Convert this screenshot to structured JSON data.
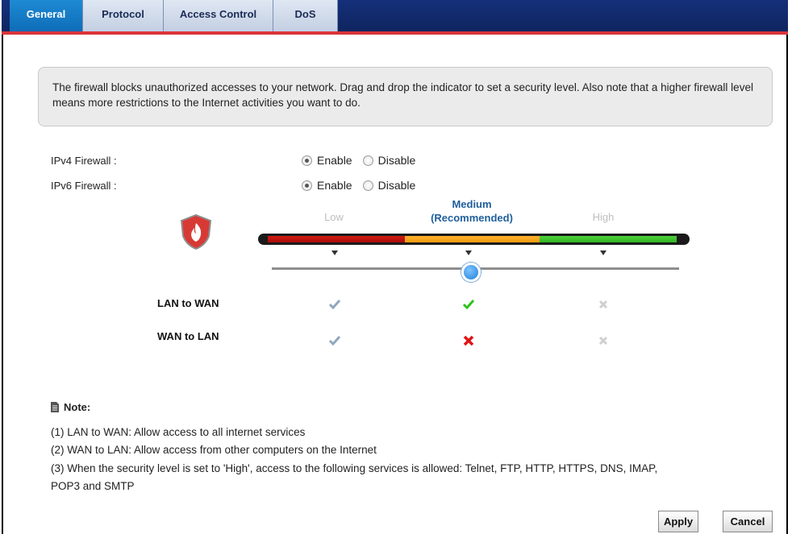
{
  "tabs": [
    {
      "label": "General",
      "active": true
    },
    {
      "label": "Protocol",
      "active": false
    },
    {
      "label": "Access Control",
      "active": false
    },
    {
      "label": "DoS",
      "active": false
    }
  ],
  "description": "The firewall blocks unauthorized accesses to your network. Drag and drop the indicator to set a security level. Also note that a higher firewall level means more restrictions to the Internet activities you want to do.",
  "ipv4": {
    "label": "IPv4 Firewall :",
    "options": [
      "Enable",
      "Disable"
    ],
    "selected": "Enable"
  },
  "ipv6": {
    "label": "IPv6 Firewall :",
    "options": [
      "Enable",
      "Disable"
    ],
    "selected": "Enable"
  },
  "levels": {
    "low": "Low",
    "medium_line1": "Medium",
    "medium_line2": "(Recommended)",
    "high": "High",
    "selected": "Medium"
  },
  "matrix": {
    "rows": [
      {
        "label": "LAN to WAN",
        "low": "check-gray",
        "medium": "check-green",
        "high": "cross-gray"
      },
      {
        "label": "WAN to LAN",
        "low": "check-gray",
        "medium": "cross-red",
        "high": "cross-gray"
      }
    ]
  },
  "note": {
    "title": "Note:",
    "lines": [
      "(1) LAN to WAN: Allow access to all internet services",
      "(2) WAN to LAN: Allow access from other computers on the Internet",
      "(3) When the security level is set to 'High', access to the following services is allowed: Telnet, FTP, HTTP, HTTPS, DNS, IMAP,",
      "POP3 and SMTP"
    ]
  },
  "buttons": {
    "apply": "Apply",
    "cancel": "Cancel"
  },
  "colors": {
    "tab_bar": "#15307a",
    "tab_active": "#1d8ad3",
    "accent_line": "#d9343a",
    "low": "#d11a12",
    "medium": "#f19a0e",
    "high": "#2fb222",
    "medium_label": "#1f5f9c"
  }
}
